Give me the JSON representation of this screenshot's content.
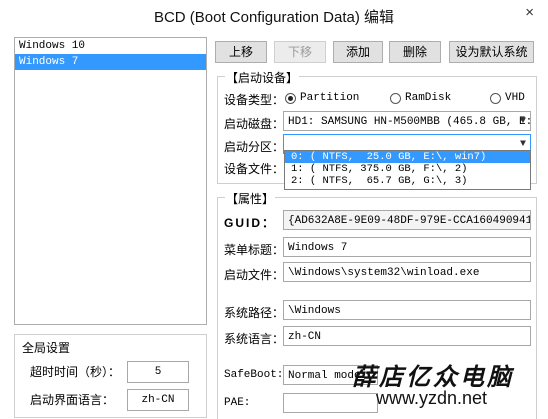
{
  "window": {
    "title": "BCD (Boot Configuration Data) 编辑",
    "close_glyph": "×"
  },
  "os_list": {
    "items": [
      {
        "label": "Windows 10",
        "selected": false
      },
      {
        "label": "Windows 7",
        "selected": true
      }
    ]
  },
  "buttons": {
    "up": "上移",
    "down": "下移",
    "add": "添加",
    "delete": "删除",
    "set_default": "设为默认系统"
  },
  "boot_device": {
    "group_title": "【启动设备】",
    "type_label": "设备类型：",
    "types": {
      "partition": "Partition",
      "ramdisk": "RamDisk",
      "vhd": "VHD"
    },
    "selected_type": "partition",
    "disk_label": "启动磁盘：",
    "disk_value": "HD1: SAMSUNG HN-M500MBB (465.8 GB, E:",
    "partition_label": "启动分区：",
    "partition_value": "",
    "device_file_label": "设备文件：",
    "partition_options": [
      "0: ( NTFS,  25.0 GB, E:\\, win7)",
      "1: ( NTFS, 375.0 GB, F:\\, 2)",
      "2: ( NTFS,  65.7 GB, G:\\, 3)"
    ]
  },
  "properties": {
    "group_title": "【属性】",
    "guid_label": "GUID：",
    "guid_value": "{AD632A8E-9E09-48DF-979E-CCA160490941}",
    "menu_title_label": "菜单标题：",
    "menu_title_value": "Windows 7",
    "boot_file_label": "启动文件：",
    "boot_file_value": "\\Windows\\system32\\winload.exe",
    "system_path_label": "系统路径：",
    "system_path_value": "\\Windows",
    "system_lang_label": "系统语言：",
    "system_lang_value": "zh-CN",
    "safeboot_label": "SafeBoot:",
    "safeboot_value": "Normal mode",
    "pae_label": "PAE:"
  },
  "global_settings": {
    "title": "全局设置",
    "timeout_label": "超时时间（秒）：",
    "timeout_value": "5",
    "ui_lang_label": "启动界面语言：",
    "ui_lang_value": "zh-CN"
  },
  "watermark": {
    "line1": "薛店亿众电脑",
    "line2": "www.yzdn.net"
  }
}
